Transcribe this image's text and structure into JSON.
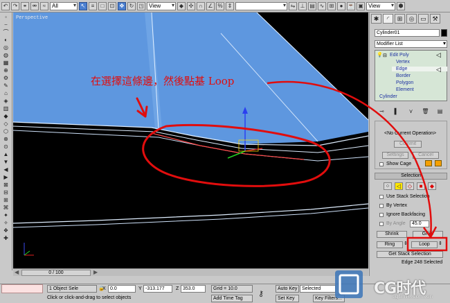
{
  "toolbar": {
    "selection_filter": "All",
    "reference_coord": "View",
    "reference_coord_right": "View"
  },
  "viewport": {
    "label": "Perspective"
  },
  "annotation": {
    "text": "在選擇這條邊，然後點基 Loop"
  },
  "timeline": {
    "frame_counter": "0 / 100"
  },
  "command_panel": {
    "object_name": "Cylinder01",
    "modifier_list": "Modifier List",
    "stack": {
      "modifier": "Edit Poly",
      "subobjects": [
        "Vertex",
        "Edge",
        "Border",
        "Polygon",
        "Element"
      ],
      "base_object": "Cylinder"
    },
    "edit_geometry": {
      "no_operation": "<No Current Operation>",
      "commit": "Commit",
      "settings": "Settings",
      "cancel": "Cancel",
      "show_cage": "Show Cage"
    },
    "selection": {
      "title": "Selection",
      "use_stack": "Use Stack Selection",
      "by_vertex": "By Vertex",
      "ignore_backfacing": "Ignore Backfacing",
      "by_angle": "By Angle",
      "angle_value": "45.0",
      "shrink": "Shrink",
      "grow": "Grow",
      "ring": "Ring",
      "loop": "Loop",
      "get_stack": "Get Stack Selection",
      "status": "Edge 248 Selected"
    }
  },
  "statusbar": {
    "selection_count": "1 Object Sele",
    "prompt": "Click or click-and-drag to select objects",
    "x_label": "X",
    "x_value": "0.0",
    "y_label": "Y",
    "y_value": "-313.177",
    "z_label": "Z",
    "z_value": "353.0",
    "grid": "Grid = 10.0",
    "add_time_tag": "Add Time Tag",
    "auto_key": "Auto Key",
    "auto_key_mode": "Selected",
    "set_key": "Set Key",
    "key_filters": "Key Filters..."
  },
  "watermark": {
    "logo": "CG时代",
    "url": "cgtime.com.cn"
  },
  "colors": {
    "annotation_red": "#e10d0d",
    "mesh_blue": "#5e97df",
    "selected_edge": "#ff4a4a"
  }
}
